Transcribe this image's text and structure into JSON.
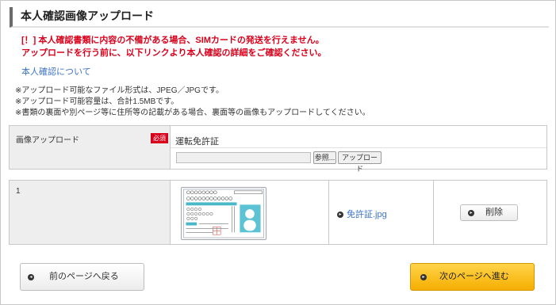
{
  "title": "本人確認画像アップロード",
  "warning": {
    "line1": "[！] 本人確認書類に内容の不備がある場合、SIMカードの発送を行えません。",
    "line2": "アップロードを行う前に、以下リンクより本人確認の詳細をご確認ください。"
  },
  "link_label": "本人確認について",
  "notes": [
    "※アップロード可能なファイル形式は、JPEG／JPGです。",
    "※アップロード可能容量は、合計1.5MBです。",
    "※書類の裏面や別ページ等に住所等の記載がある場合、裏面等の画像もアップロードしてください。"
  ],
  "upload": {
    "label": "画像アップロード",
    "required": "必須",
    "doc_type": "運転免許証",
    "browse_label": "参照...",
    "upload_label": "アップロード"
  },
  "file_row": {
    "index": "1",
    "filename": "免許証.jpg",
    "delete_label": "削除"
  },
  "nav": {
    "prev_label": "前のページへ戻る",
    "next_label": "次のページへ進む"
  }
}
